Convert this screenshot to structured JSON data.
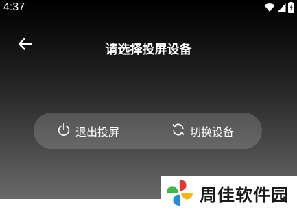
{
  "status_bar": {
    "time": "4:37",
    "icons": [
      "wifi-icon",
      "cellular-signal-icon",
      "battery-charging-icon"
    ]
  },
  "header": {
    "back_icon": "arrow-left-icon",
    "title": "请选择投屏设备"
  },
  "actions": {
    "exit": {
      "icon": "power-icon",
      "label": "退出投屏"
    },
    "switch": {
      "icon": "refresh-icon",
      "label": "切换设备"
    }
  },
  "watermark": {
    "text": "周佳软件园",
    "logo": "pinwheel-logo"
  },
  "colors": {
    "text": "#ffffff",
    "logo_red": "#e8352a",
    "logo_yellow": "#f6b71a",
    "logo_green": "#43b649",
    "logo_blue": "#1f8fd8"
  }
}
